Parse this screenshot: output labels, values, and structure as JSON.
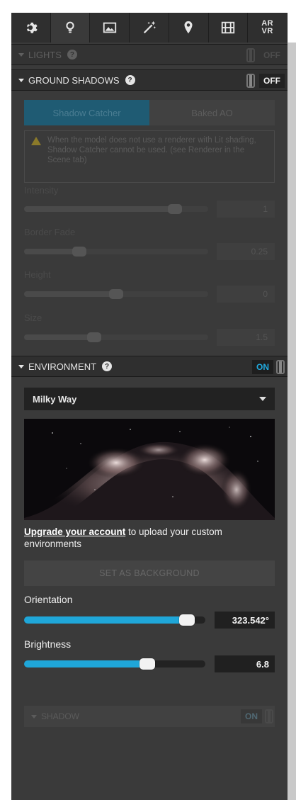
{
  "toolbar": {
    "tabs": [
      {
        "icon": "gear-icon"
      },
      {
        "icon": "lightbulb-icon"
      },
      {
        "icon": "image-icon"
      },
      {
        "icon": "magic-wand-icon"
      },
      {
        "icon": "location-pin-icon"
      },
      {
        "icon": "film-icon"
      },
      {
        "icon": "ar-vr-icon",
        "label_top": "AR",
        "label_bottom": "VR"
      }
    ],
    "active_index": 1
  },
  "lights": {
    "title": "LIGHTS",
    "state": "OFF",
    "help": "?"
  },
  "ground_shadows": {
    "title": "GROUND SHADOWS",
    "state": "OFF",
    "help": "?",
    "segments": [
      "Shadow Catcher",
      "Baked AO"
    ],
    "selected_segment": "Shadow Catcher",
    "warning": "When the model does not use a renderer with Lit shading, Shadow Catcher cannot be used. (see Renderer in the Scene tab)",
    "controls": [
      {
        "label": "Intensity",
        "value": "1",
        "fraction": 0.82
      },
      {
        "label": "Border Fade",
        "value": "0.25",
        "fraction": 0.3
      },
      {
        "label": "Height",
        "value": "0",
        "fraction": 0.5
      },
      {
        "label": "Size",
        "value": "1.5",
        "fraction": 0.38
      }
    ]
  },
  "environment": {
    "title": "ENVIRONMENT",
    "state": "ON",
    "help": "?",
    "selected_environment": "Milky Way",
    "upgrade_link": "Upgrade your account",
    "upgrade_rest": " to upload your custom environments",
    "set_background_label": "SET AS BACKGROUND",
    "orientation": {
      "label": "Orientation",
      "value": "323.542°",
      "fraction": 0.9
    },
    "brightness": {
      "label": "Brightness",
      "value": "6.8",
      "fraction": 0.68
    },
    "shadow": {
      "title": "SHADOW",
      "state": "ON"
    }
  },
  "colors": {
    "accent": "#1fa6d8",
    "panel_bg": "#3a3a3a",
    "header_bg": "#2f2f2f"
  }
}
